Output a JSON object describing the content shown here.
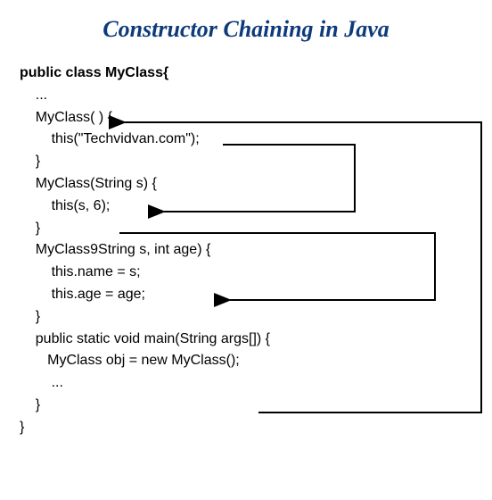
{
  "title": "Constructor Chaining in Java",
  "code": {
    "l1": "public class MyClass{",
    "l2": "    ...",
    "l3": "    MyClass( ) {",
    "l4": "        this(\"Techvidvan.com\");",
    "l5": "",
    "l6": "    }",
    "l7": "    MyClass(String s) {",
    "l8": "        this(s, 6);",
    "l9": "",
    "l10": "    }",
    "l11": "    MyClass9String s, int age) {",
    "l12": "        this.name = s;",
    "l13": "        this.age = age;",
    "l14": "    }",
    "l15": "    public static void main(String args[]) {",
    "l16": "       MyClass obj = new MyClass();",
    "l17": "        ...",
    "l18": "    }",
    "l19": "}"
  }
}
